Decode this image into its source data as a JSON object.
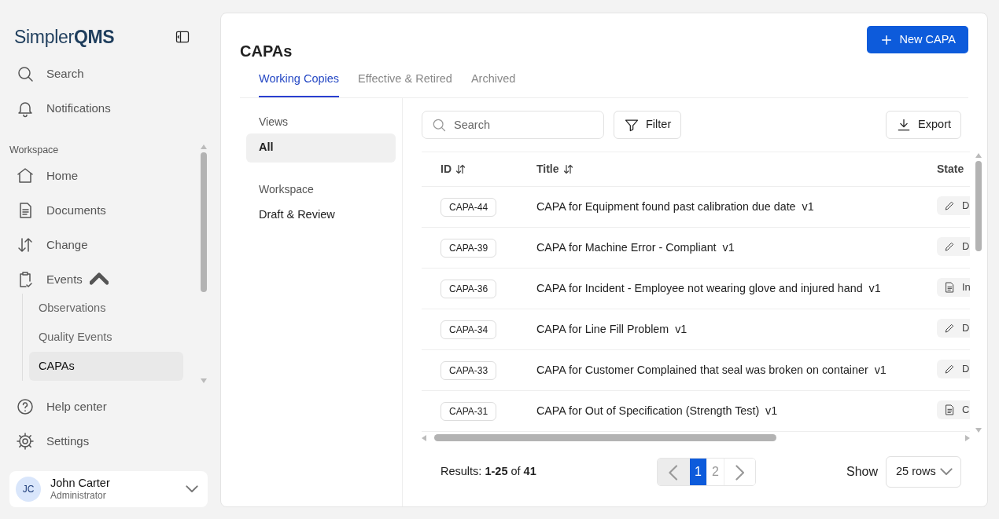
{
  "sidebar": {
    "logo": "Simpler**QMS**",
    "top_items": [
      {
        "label": "Search",
        "selected": false
      },
      {
        "label": "Notifications",
        "selected": false
      }
    ],
    "section_label": "Workspace",
    "items": [
      {
        "label": "Home",
        "selected": false
      },
      {
        "label": "Documents",
        "selected": false
      },
      {
        "label": "Change",
        "selected": false
      },
      {
        "label": "Events",
        "selected": false,
        "expanded": true,
        "children": [
          {
            "label": "Observations",
            "selected": false
          },
          {
            "label": "Quality Events",
            "selected": false
          },
          {
            "label": "CAPAs",
            "selected": true
          }
        ]
      }
    ],
    "bottom_items": [
      {
        "label": "Help center",
        "selected": false
      },
      {
        "label": "Settings",
        "selected": false
      }
    ],
    "user": {
      "initials": "JC",
      "name": "John Carter",
      "role": "Administrator"
    }
  },
  "main": {
    "title": "CAPAs",
    "new_button": "New CAPA",
    "tabs": [
      {
        "label": "Working Copies",
        "selected": true
      },
      {
        "label": "Effective & Retired",
        "selected": false
      },
      {
        "label": "Archived",
        "selected": false
      }
    ],
    "views": {
      "heading": "Views",
      "items": [
        {
          "label": "All",
          "selected": true
        }
      ],
      "section": "Workspace",
      "section_items": [
        {
          "label": "Draft & Review",
          "selected": false
        }
      ]
    },
    "search": {
      "placeholder": "Search"
    },
    "filter_button": "Filter",
    "export_button": "Export",
    "table": {
      "columns": [
        "ID",
        "Title",
        "State"
      ],
      "rows": [
        {
          "id": "CAPA-44",
          "title": "CAPA for Equipment found past calibration due date  v1",
          "state": {
            "kind": "draft",
            "label": "D"
          }
        },
        {
          "id": "CAPA-39",
          "title": "CAPA for Machine Error - Compliant  v1",
          "state": {
            "kind": "draft",
            "label": "D"
          }
        },
        {
          "id": "CAPA-36",
          "title": "CAPA for Incident - Employee not wearing glove and injured hand  v1",
          "state": {
            "kind": "document",
            "label": "In"
          }
        },
        {
          "id": "CAPA-34",
          "title": "CAPA for Line Fill Problem  v1",
          "state": {
            "kind": "draft",
            "label": "D"
          }
        },
        {
          "id": "CAPA-33",
          "title": "CAPA for Customer Complained that seal was broken on container  v1",
          "state": {
            "kind": "draft",
            "label": "D"
          }
        },
        {
          "id": "CAPA-31",
          "title": "CAPA for Out of Specification (Strength Test)  v1",
          "state": {
            "kind": "document",
            "label": "C"
          }
        }
      ]
    },
    "footer": {
      "results": "Results: **1-25** of **41**",
      "pages": [
        {
          "label": "1",
          "selected": true
        },
        {
          "label": "2",
          "selected": false
        }
      ],
      "show_label": "Show",
      "rows_select": "25 rows"
    }
  }
}
